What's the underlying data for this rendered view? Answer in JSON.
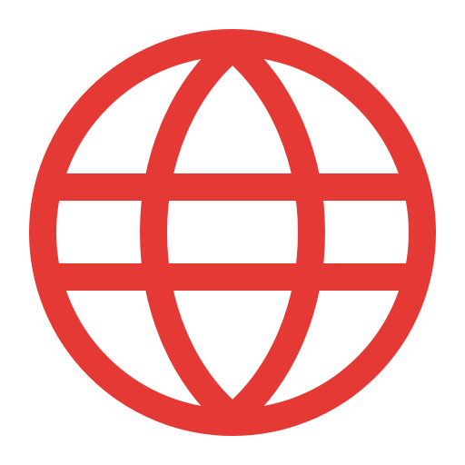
{
  "icon": {
    "name": "globe-icon",
    "color": "#E53935",
    "background": "#FFFFFF"
  }
}
